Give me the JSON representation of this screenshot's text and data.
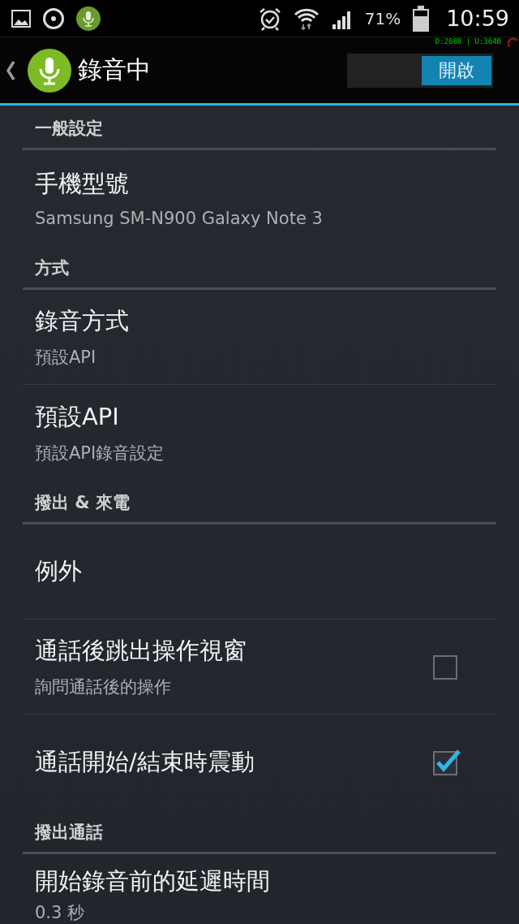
{
  "status_bar": {
    "battery": "71%",
    "time": "10:59",
    "traffic": "D:208B  | U:364B"
  },
  "action_bar": {
    "title": "錄音中",
    "switch": {
      "label": "開啟",
      "on": true
    }
  },
  "items": [
    {
      "kind": "header",
      "title": "一般設定"
    },
    {
      "kind": "pref",
      "title": "手機型號",
      "summary": "Samsung SM-N900 Galaxy Note 3"
    },
    {
      "kind": "header",
      "title": "方式"
    },
    {
      "kind": "pref",
      "title": "錄音方式",
      "summary": "預設API"
    },
    {
      "kind": "pref",
      "title": "預設API",
      "summary": "預設API錄音設定"
    },
    {
      "kind": "header",
      "title": "撥出 & 來電"
    },
    {
      "kind": "pref",
      "title": "例外"
    },
    {
      "kind": "checkbox",
      "title": "通話後跳出操作視窗",
      "summary": "詢問通話後的操作",
      "checked": false
    },
    {
      "kind": "checkbox",
      "title": "通話開始/結束時震動",
      "checked": true
    },
    {
      "kind": "header",
      "title": "撥出通話"
    },
    {
      "kind": "pref",
      "title": "開始錄音前的延遲時間",
      "summary": "0.3 秒"
    }
  ]
}
